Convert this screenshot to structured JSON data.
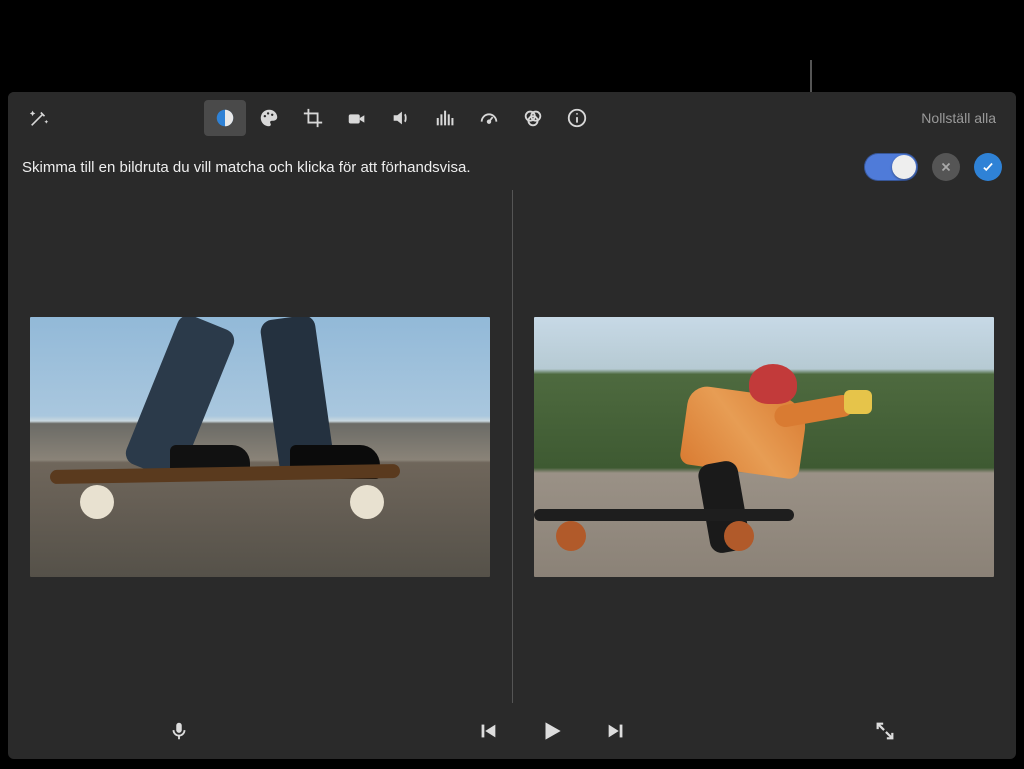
{
  "toolbar": {
    "reset_all_label": "Nollställ alla",
    "buttons": {
      "magic": "magic-wand-icon",
      "color_balance": "color-balance-icon",
      "color_correction": "color-palette-icon",
      "crop": "crop-icon",
      "stabilize": "camera-icon",
      "volume": "volume-icon",
      "noise": "equalizer-icon",
      "speed": "speedometer-icon",
      "filters": "overlap-circles-icon",
      "info": "info-icon"
    },
    "active_button": "color_balance"
  },
  "hint": {
    "text": "Skimma till en bildruta du vill matcha och klicka för att förhandsvisa."
  },
  "controls": {
    "toggle_on": true,
    "cancel_label": "cancel",
    "confirm_label": "confirm"
  },
  "preview": {
    "left_description": "skateboard-road-clip",
    "right_description": "longboard-rider-clip"
  },
  "playback": {
    "mic_label": "voiceover",
    "prev_label": "previous-frame",
    "play_label": "play",
    "next_label": "next-frame",
    "fullscreen_label": "fullscreen"
  }
}
